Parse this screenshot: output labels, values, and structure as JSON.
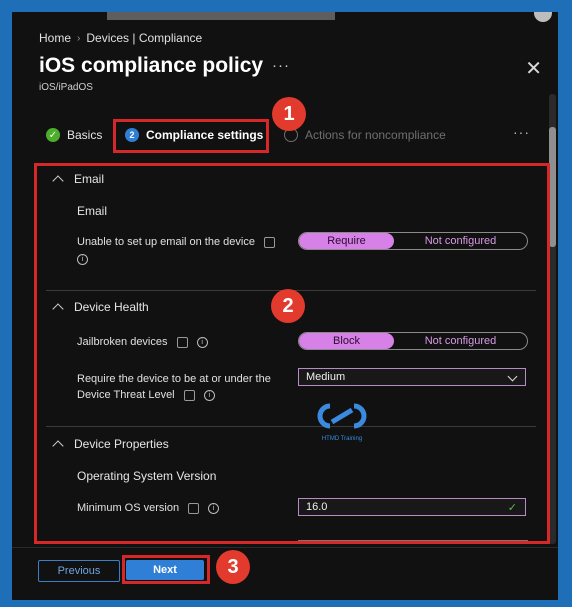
{
  "breadcrumb": {
    "home": "Home",
    "separator": "›",
    "page": "Devices | Compliance"
  },
  "header": {
    "title": "iOS compliance policy",
    "more": "···",
    "subtitle": "iOS/iPadOS",
    "close": "✕"
  },
  "tabs": [
    {
      "label": "Basics",
      "state": "completed",
      "icon": "check-icon"
    },
    {
      "label": "Compliance settings",
      "state": "active",
      "step": "2"
    },
    {
      "label": "Actions for noncompliance",
      "state": "disabled"
    }
  ],
  "tabs_more": "···",
  "sections": {
    "email": {
      "title": "Email",
      "subheading": "Email",
      "setting_label": "Unable to set up email on the device",
      "toggle": {
        "on": "Require",
        "off": "Not configured"
      }
    },
    "device_health": {
      "title": "Device Health",
      "jailbroken_label": "Jailbroken devices",
      "jailbroken_toggle": {
        "on": "Block",
        "off": "Not configured"
      },
      "threat_label_line1": "Require the device to be at or under the",
      "threat_label_line2": "Device Threat Level",
      "threat_value": "Medium"
    },
    "device_properties": {
      "title": "Device Properties",
      "subheading": "Operating System Version",
      "min_os_label": "Minimum OS version",
      "min_os_value": "16.0"
    }
  },
  "watermark": {
    "logo": "HTMD",
    "text": "HTMD Training"
  },
  "footer": {
    "previous": "Previous",
    "next": "Next"
  },
  "callouts": [
    "1",
    "2",
    "3"
  ],
  "colors": {
    "accent": "#2f7fd6",
    "toggle_on": "#d781e8",
    "highlight": "#d62828",
    "badge": "#e33a2e",
    "success": "#4caf2c"
  }
}
